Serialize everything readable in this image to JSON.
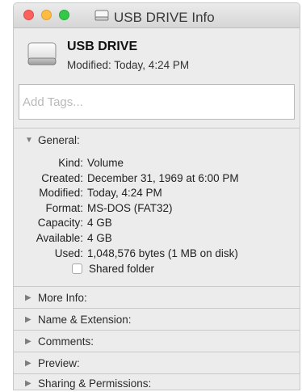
{
  "window": {
    "title": "USB DRIVE Info"
  },
  "header": {
    "name": "USB DRIVE",
    "modified": "Modified: Today, 4:24 PM"
  },
  "tags": {
    "placeholder": "Add Tags..."
  },
  "general": {
    "label": "General:",
    "rows": [
      {
        "key": "Kind:",
        "value": "Volume"
      },
      {
        "key": "Created:",
        "value": "December 31, 1969 at 6:00 PM"
      },
      {
        "key": "Modified:",
        "value": "Today, 4:24 PM"
      },
      {
        "key": "Format:",
        "value": "MS-DOS (FAT32)"
      },
      {
        "key": "Capacity:",
        "value": "4 GB"
      },
      {
        "key": "Available:",
        "value": "4 GB"
      },
      {
        "key": "Used:",
        "value": "1,048,576 bytes (1 MB on disk)"
      }
    ],
    "shared_folder_label": "Shared folder",
    "shared_folder_checked": false
  },
  "sections": [
    {
      "label": "More Info:"
    },
    {
      "label": "Name & Extension:"
    },
    {
      "label": "Comments:"
    },
    {
      "label": "Preview:"
    },
    {
      "label": "Sharing & Permissions:"
    }
  ],
  "icons": {
    "close": "close-button-icon",
    "minimize": "minimize-button-icon",
    "zoom": "zoom-button-icon",
    "drive": "usb-drive-icon",
    "disclosure_open": "triangle-down-icon",
    "disclosure_closed": "triangle-right-icon"
  },
  "colors": {
    "window_bg": "#ececec",
    "close": "#fc605c",
    "minimize": "#fdbc40",
    "zoom": "#34c84a"
  }
}
